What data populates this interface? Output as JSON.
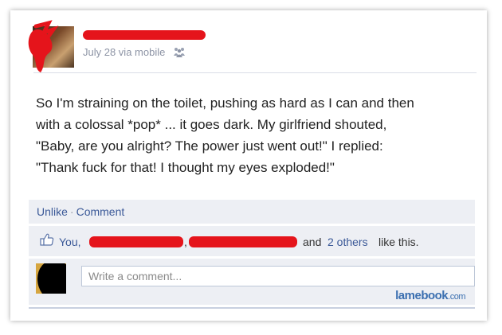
{
  "post": {
    "meta_date": "July 28 via mobile",
    "text": "So I'm straining on the toilet, pushing as hard as I can and then\nwith a colossal *pop* ... it goes dark. My girlfriend shouted,\n\"Baby, are you alright? The power just went out!\" I replied:\n\"Thank fuck for that! I thought my eyes exploded!\"",
    "privacy_icon": "friends-icon"
  },
  "actions": {
    "unlike_label": "Unlike",
    "separator": "·",
    "comment_label": "Comment"
  },
  "likes": {
    "icon": "thumbs-up-icon",
    "you_label": "You,",
    "comma": ",",
    "and_text": "and",
    "others_link": "2 others",
    "suffix": "like this."
  },
  "comment": {
    "placeholder": "Write a comment..."
  },
  "watermark": {
    "brand": "lamebook",
    "tld": ".com"
  },
  "colors": {
    "redaction": "#e5141b",
    "link": "#3b5998",
    "panel_bg": "#edeff4"
  }
}
